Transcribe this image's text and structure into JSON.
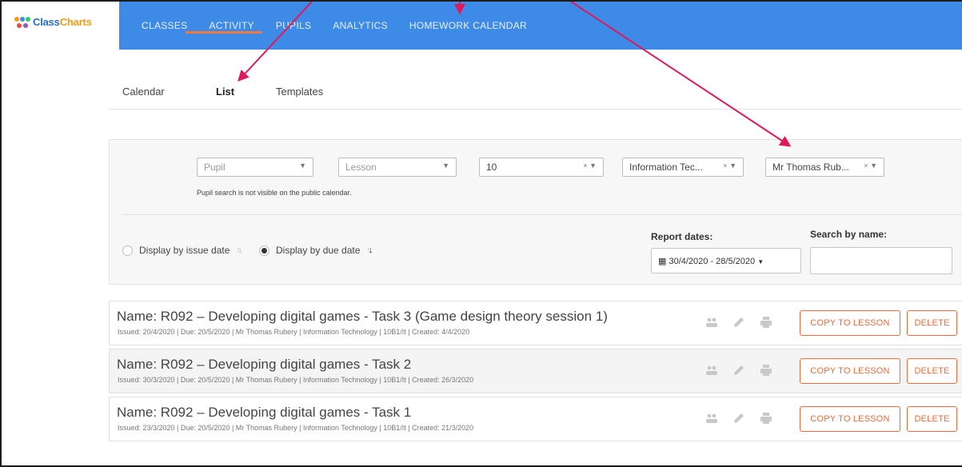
{
  "brand": {
    "name_part1": "Class",
    "name_part2": "Charts"
  },
  "nav": [
    "CLASSES",
    "ACTIVITY",
    "PUPILS",
    "ANALYTICS",
    "HOMEWORK CALENDAR"
  ],
  "tabs": [
    {
      "label": "Calendar",
      "active": false
    },
    {
      "label": "List",
      "active": true
    },
    {
      "label": "Templates",
      "active": false
    }
  ],
  "filters": {
    "pupil_placeholder": "Pupil",
    "lesson_placeholder": "Lesson",
    "year_value": "10",
    "subject_value": "Information Tec...",
    "teacher_value": "Mr Thomas Rub...",
    "pupil_hint": "Pupil search is not visible on the public calendar.",
    "clear_glyph": "×",
    "caret_glyph": "▼"
  },
  "display": {
    "issue_label": "Display by issue date",
    "due_label": "Display by due date",
    "selected": "due"
  },
  "report": {
    "label": "Report dates:",
    "range": "30/4/2020 - 28/5/2020"
  },
  "search": {
    "label": "Search by name:",
    "value": ""
  },
  "buttons": {
    "copy": "COPY TO LESSON",
    "delete": "DELETE"
  },
  "rows": [
    {
      "title": "Name: R092 – Developing digital games - Task 3 (Game design theory session 1)",
      "meta": "Issued: 20/4/2020 | Due: 20/5/2020 | Mr Thomas Rubery | Information Technology | 10B1/It | Created: 4/4/2020"
    },
    {
      "title": "Name: R092 – Developing digital games - Task 2",
      "meta": "Issued: 30/3/2020 | Due: 20/5/2020 | Mr Thomas Rubery | Information Technology | 10B1/It | Created: 26/3/2020"
    },
    {
      "title": "Name: R092 – Developing digital games - Task 1",
      "meta": "Issued: 23/3/2020 | Due: 20/5/2020 | Mr Thomas Rubery | Information Technology | 10B1/It | Created: 21/3/2020"
    }
  ],
  "colors": {
    "nav_bg": "#3d8be6",
    "accent": "#ee6b3b",
    "annotation": "#e0195a"
  }
}
